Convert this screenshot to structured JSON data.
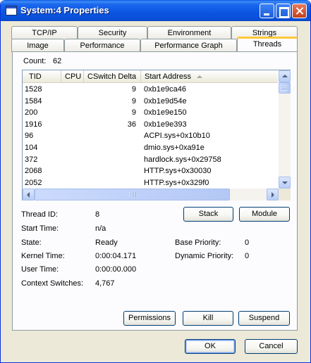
{
  "window": {
    "title": "System:4 Properties"
  },
  "tabs": {
    "row1": [
      "TCP/IP",
      "Security",
      "Environment",
      "Strings"
    ],
    "row2": [
      "Image",
      "Performance",
      "Performance Graph",
      "Threads"
    ],
    "active": "Threads"
  },
  "threads": {
    "count_label": "Count:",
    "count_value": "62",
    "columns": [
      "TID",
      "CPU",
      "CSwitch Delta",
      "Start Address"
    ],
    "sort_column": "Start Address",
    "rows": [
      {
        "tid": "1528",
        "cpu": "",
        "cswitch": "9",
        "address": "0xb1e9ca46"
      },
      {
        "tid": "1584",
        "cpu": "",
        "cswitch": "9",
        "address": "0xb1e9d54e"
      },
      {
        "tid": "200",
        "cpu": "",
        "cswitch": "9",
        "address": "0xb1e9e150"
      },
      {
        "tid": "1916",
        "cpu": "",
        "cswitch": "36",
        "address": "0xb1e9e393"
      },
      {
        "tid": "96",
        "cpu": "",
        "cswitch": "",
        "address": "ACPI.sys+0x10b10"
      },
      {
        "tid": "104",
        "cpu": "",
        "cswitch": "",
        "address": "dmio.sys+0xa91e"
      },
      {
        "tid": "372",
        "cpu": "",
        "cswitch": "",
        "address": "hardlock.sys+0x29758"
      },
      {
        "tid": "2068",
        "cpu": "",
        "cswitch": "",
        "address": "HTTP.sys+0x30030"
      },
      {
        "tid": "2052",
        "cpu": "",
        "cswitch": "",
        "address": "HTTP.sys+0x329f0"
      }
    ]
  },
  "details": {
    "thread_id_label": "Thread ID:",
    "thread_id_value": "8",
    "start_time_label": "Start Time:",
    "start_time_value": "n/a",
    "state_label": "State:",
    "state_value": "Ready",
    "base_priority_label": "Base Priority:",
    "base_priority_value": "0",
    "kernel_time_label": "Kernel Time:",
    "kernel_time_value": "0:00:04.171",
    "dynamic_priority_label": "Dynamic Priority:",
    "dynamic_priority_value": "0",
    "user_time_label": "User Time:",
    "user_time_value": "0:00:00.000",
    "context_switches_label": "Context Switches:",
    "context_switches_value": "4,767"
  },
  "buttons": {
    "stack": "Stack",
    "module": "Module",
    "permissions": "Permissions",
    "kill": "Kill",
    "suspend": "Suspend",
    "ok": "OK",
    "cancel": "Cancel"
  },
  "colors": {
    "titlebar": "#0A55E0",
    "dialog_bg": "#ECE9D8",
    "active_tab_accent": "#FFC83C"
  }
}
